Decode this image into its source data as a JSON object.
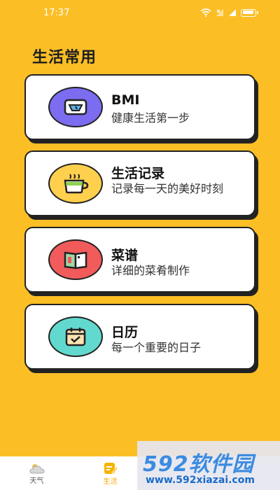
{
  "status_bar": {
    "time": "17:37"
  },
  "page_title": "生活常用",
  "cards": [
    {
      "title": "BMI",
      "desc": "健康生活第一步",
      "icon": "scale-icon",
      "color": "#7B6CF0"
    },
    {
      "title": "生活记录",
      "desc": "记录每一天的美好时刻",
      "icon": "coffee-cup-icon",
      "color": "#FFD04D"
    },
    {
      "title": "菜谱",
      "desc": "详细的菜肴制作",
      "icon": "book-icon",
      "color": "#F15B5B"
    },
    {
      "title": "日历",
      "desc": "每一个重要的日子",
      "icon": "calendar-check-icon",
      "color": "#62D9CF"
    }
  ],
  "tabbar": {
    "tabs": [
      {
        "label": "天气",
        "icon": "weather-icon"
      },
      {
        "label": "生活",
        "icon": "life-icon",
        "active": true
      }
    ]
  },
  "watermark": {
    "brand": "592软件园",
    "url": "www.592xiazai.com"
  }
}
